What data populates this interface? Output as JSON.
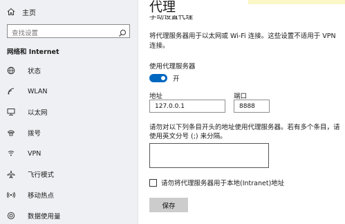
{
  "sidebar": {
    "home_label": "主页",
    "search_placeholder": "查找设置",
    "section_title": "网络和 Internet",
    "items": [
      {
        "label": "状态",
        "icon": "globe-icon"
      },
      {
        "label": "WLAN",
        "icon": "wifi-icon"
      },
      {
        "label": "以太网",
        "icon": "ethernet-icon"
      },
      {
        "label": "拨号",
        "icon": "dialup-icon"
      },
      {
        "label": "VPN",
        "icon": "vpn-icon"
      },
      {
        "label": "飞行模式",
        "icon": "airplane-icon"
      },
      {
        "label": "移动热点",
        "icon": "hotspot-icon"
      },
      {
        "label": "数据使用量",
        "icon": "data-usage-icon"
      }
    ]
  },
  "main": {
    "title": "代理",
    "subheading": "手动设置代理",
    "description": "将代理服务器用于以太网或 Wi-Fi 连接。这些设置不适用于 VPN 连接。",
    "use_proxy_label": "使用代理服务器",
    "toggle_state": "开",
    "address_label": "地址",
    "address_value": "127.0.0.1",
    "port_label": "端口",
    "port_value": "8888",
    "exceptions_description": "请勿对以下列条目开头的地址使用代理服务器。若有多个条目，请使用英文分号 (;) 来分隔。",
    "exceptions_value": "",
    "local_bypass_label": "请勿将代理服务器用于本地(Intranet)地址",
    "save_label": "保存"
  },
  "colors": {
    "accent": "#0067c0",
    "sidebar_bg": "#eef0f3",
    "button_bg": "#cccccc"
  }
}
